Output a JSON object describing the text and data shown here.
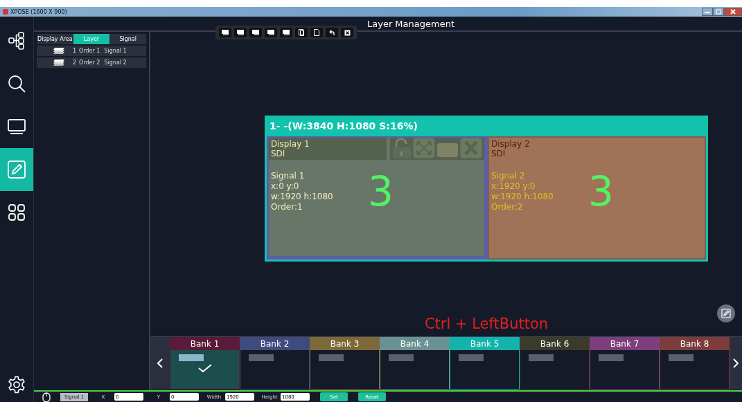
{
  "window": {
    "title": "XPOSE (1600 X 900)"
  },
  "nav": [
    {
      "kind": "topology",
      "selected": false
    },
    {
      "kind": "search",
      "selected": false
    },
    {
      "kind": "monitor",
      "selected": false
    },
    {
      "kind": "edit",
      "selected": true
    },
    {
      "kind": "apps",
      "selected": false
    },
    {
      "kind": "settings",
      "selected": false
    }
  ],
  "header": {
    "title": "Layer Management"
  },
  "layer_panel": {
    "tabs": [
      {
        "label": "Display Area",
        "selected": false
      },
      {
        "label": "Layer",
        "selected": true
      },
      {
        "label": "Signal",
        "selected": false
      }
    ],
    "rows": [
      {
        "index": "1",
        "order": "Order 1",
        "signal": "Signal 1"
      },
      {
        "index": "2",
        "order": "Order 2",
        "signal": "Signal 2"
      }
    ]
  },
  "screen": {
    "title": "1- -(W:3840 H:1080 S:16%)",
    "displays": [
      {
        "name": "Display 1",
        "type": "SDI",
        "signal": "Signal  1",
        "position": "x:0  y:0",
        "size": "w:1920  h:1080",
        "order": "Order:1",
        "number": "3",
        "selected": true
      },
      {
        "name": "Display 2",
        "type": "SDI",
        "signal": "Signal  2",
        "position": "x:1920  y:0",
        "size": "w:1920  h:1080",
        "order": "Order:2",
        "number": "3",
        "selected": false
      }
    ]
  },
  "hint": "Ctrl + LeftButton",
  "banks": [
    {
      "label": "Bank 1",
      "color": "#5a1a38",
      "selected": true
    },
    {
      "label": "Bank 2",
      "color": "#3e4b7c",
      "selected": false
    },
    {
      "label": "Bank 3",
      "color": "#7d6838",
      "selected": false
    },
    {
      "label": "Bank 4",
      "color": "#6a9292",
      "selected": false
    },
    {
      "label": "Bank 5",
      "color": "#12b3aa",
      "selected": false
    },
    {
      "label": "Bank 6",
      "color": "#3b3b2b",
      "selected": false
    },
    {
      "label": "Bank 7",
      "color": "#7c3f7c",
      "selected": false
    },
    {
      "label": "Bank 8",
      "color": "#7c3c3c",
      "selected": false
    }
  ],
  "status_bar": {
    "signal_button": "Signal  1",
    "fields": [
      {
        "label": "X",
        "value": "0"
      },
      {
        "label": "Y",
        "value": "0"
      },
      {
        "label": "Width",
        "value": "1920"
      },
      {
        "label": "Height",
        "value": "1080"
      }
    ],
    "buttons": [
      "Set",
      "Reset"
    ]
  }
}
